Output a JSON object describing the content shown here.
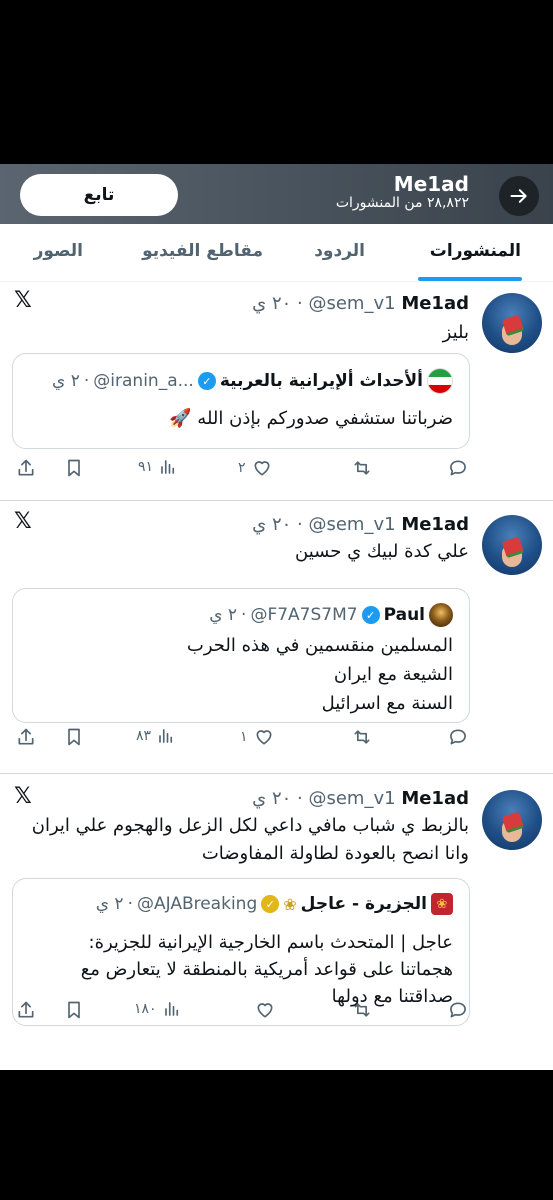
{
  "header": {
    "profile_name": "Me1ad",
    "posts_count": "٢٨,٨٢٢ من المنشورات",
    "follow_label": "تابع"
  },
  "tabs": [
    "المنشورات",
    "الردود",
    "مقاطع الفيديو",
    "الصور"
  ],
  "tweets": [
    {
      "name": "Me1ad",
      "handle": "@sem_v1",
      "time": "٢٠ ي",
      "text": "بليز",
      "quote": {
        "name": "ألأحداث ألإيرانية بالعربية",
        "handle": "@iranin_a...",
        "time": "٢ ي",
        "text": "ضرباتنا ستشفي صدوركم بإذن الله 🚀"
      },
      "stats": {
        "views": "٩١",
        "likes": "٢",
        "retweets": "",
        "replies": ""
      }
    },
    {
      "name": "Me1ad",
      "handle": "@sem_v1",
      "time": "٢٠ ي",
      "text": "علي كدة لبيك ي حسين",
      "quote": {
        "name": "Paul",
        "handle": "@F7A7S7M7",
        "time": "٢ ي",
        "text": "المسلمين منقسمين في هذه الحرب\nالشيعة مع ايران\nالسنة مع اسرائيل"
      },
      "stats": {
        "views": "٨٣",
        "likes": "١",
        "retweets": "",
        "replies": ""
      }
    },
    {
      "name": "Me1ad",
      "handle": "@sem_v1",
      "time": "٢٠ ي",
      "text": "بالزبط ي شباب مافي داعي لكل الزعل والهجوم علي ايران\nوانا انصح بالعودة لطاولة المفاوضات",
      "quote": {
        "name": "الجزيرة - عاجل",
        "handle": "@AJABreaking",
        "time": "٢ ي",
        "text": "عاجل | المتحدث باسم الخارجية الإيرانية للجزيرة:\nهجماتنا على قواعد أمريكية بالمنطقة لا يتعارض مع\nصداقتنا مع دولها"
      },
      "stats": {
        "views": "١٨٠",
        "likes": "",
        "retweets": "",
        "replies": ""
      }
    }
  ],
  "icons": {
    "back": "arrow-right-icon",
    "x": "x-logo-icon",
    "reply": "reply-icon",
    "retweet": "retweet-icon",
    "like": "heart-icon",
    "views": "views-icon",
    "bookmark": "bookmark-icon",
    "share": "share-icon",
    "verified": "verified-badge-icon"
  },
  "colors": {
    "accent": "#1d9bf0",
    "verified_blue": "#1d9bf0",
    "verified_gold": "#e2b719",
    "text": "#0f1419",
    "muted": "#536471"
  }
}
